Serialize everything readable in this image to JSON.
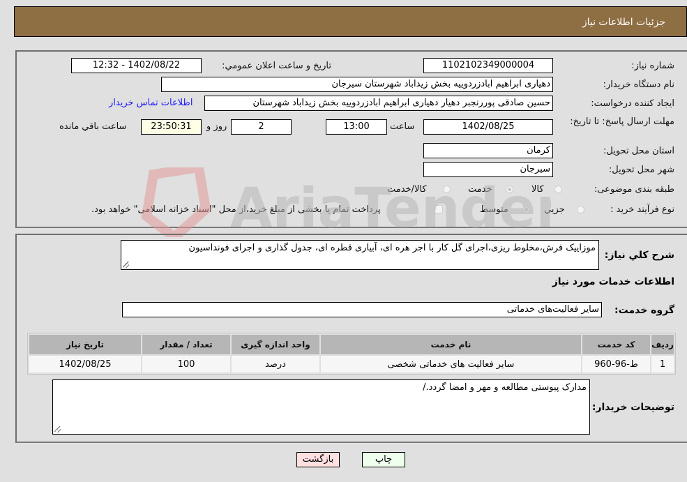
{
  "header": {
    "title": "جزئیات اطلاعات نیاز"
  },
  "form": {
    "need_number": {
      "label": "شماره نیاز:",
      "value": "1102102349000004"
    },
    "announce_datetime": {
      "label": "تاریخ و ساعت اعلان عمومي:",
      "value": "1402/08/22 - 12:32"
    },
    "buyer_org": {
      "label": "نام دستگاه خریدار:",
      "value": "دهیاری ابراهیم ابادزردوییه بخش زیداباد شهرستان سیرجان"
    },
    "requester": {
      "label": "ایجاد کننده درخواست:",
      "value": "حسین صادقی پوررنجبر دهیار دهیاری ابراهیم ابادزردوییه بخش زیداباد شهرستان",
      "contact_link": "اطلاعات تماس خریدار"
    },
    "deadline": {
      "label": "مهلت ارسال پاسخ: تا تاریخ:",
      "date": "1402/08/25",
      "time_label": "ساعت",
      "time": "13:00",
      "days": "2",
      "days_label": "روز و",
      "remaining": "23:50:31",
      "remaining_label": "ساعت باقي مانده"
    },
    "province": {
      "label": "استان محل تحویل:",
      "value": "کرمان"
    },
    "city": {
      "label": "شهر محل تحویل:",
      "value": "سیرجان"
    },
    "category": {
      "label": "طبقه بندی موضوعی:",
      "options": [
        {
          "label": "کالا",
          "checked": false
        },
        {
          "label": "خدمت",
          "checked": true
        },
        {
          "label": "کالا/خدمت",
          "checked": false
        }
      ]
    },
    "purchase_type": {
      "label": "نوع فرآیند خرید :",
      "options": [
        {
          "label": "جزیي",
          "checked": false
        },
        {
          "label": "متوسط",
          "checked": true
        }
      ],
      "treasury_checkbox": {
        "label": "پرداخت تمام یا بخشی از مبلغ خرید،از محل \"اسناد خزانه اسلامی\" خواهد بود.",
        "checked": false
      }
    }
  },
  "details": {
    "general_desc": {
      "label": "شرح کلي نیاز:",
      "value": "موزاییک فرش،مخلوط ریزی،اجرای گل کار با اجر هره ای، آبیاری قطره ای، جدول گذاری و اجرای فونداسیون"
    },
    "services_title": "اطلاعات خدمات مورد نیاز",
    "service_group": {
      "label": "گروه خدمت:",
      "value": "سایر فعالیت‌های خدماتی"
    },
    "table": {
      "headers": [
        "ردیف",
        "کد خدمت",
        "نام خدمت",
        "واحد اندازه گیری",
        "تعداد / مقدار",
        "تاریخ نیاز"
      ],
      "rows": [
        [
          "1",
          "ط-96-960",
          "سایر فعالیت های خدماتی شخصی",
          "درصد",
          "100",
          "1402/08/25"
        ]
      ]
    },
    "buyer_notes": {
      "label": "توضیحات خریدار:",
      "value": "مدارک پیوستی مطالعه و مهر و امضا گردد./"
    }
  },
  "buttons": {
    "print": "چاپ",
    "back": "بازگشت"
  },
  "watermark": {
    "text": "AriaTender.neT"
  }
}
